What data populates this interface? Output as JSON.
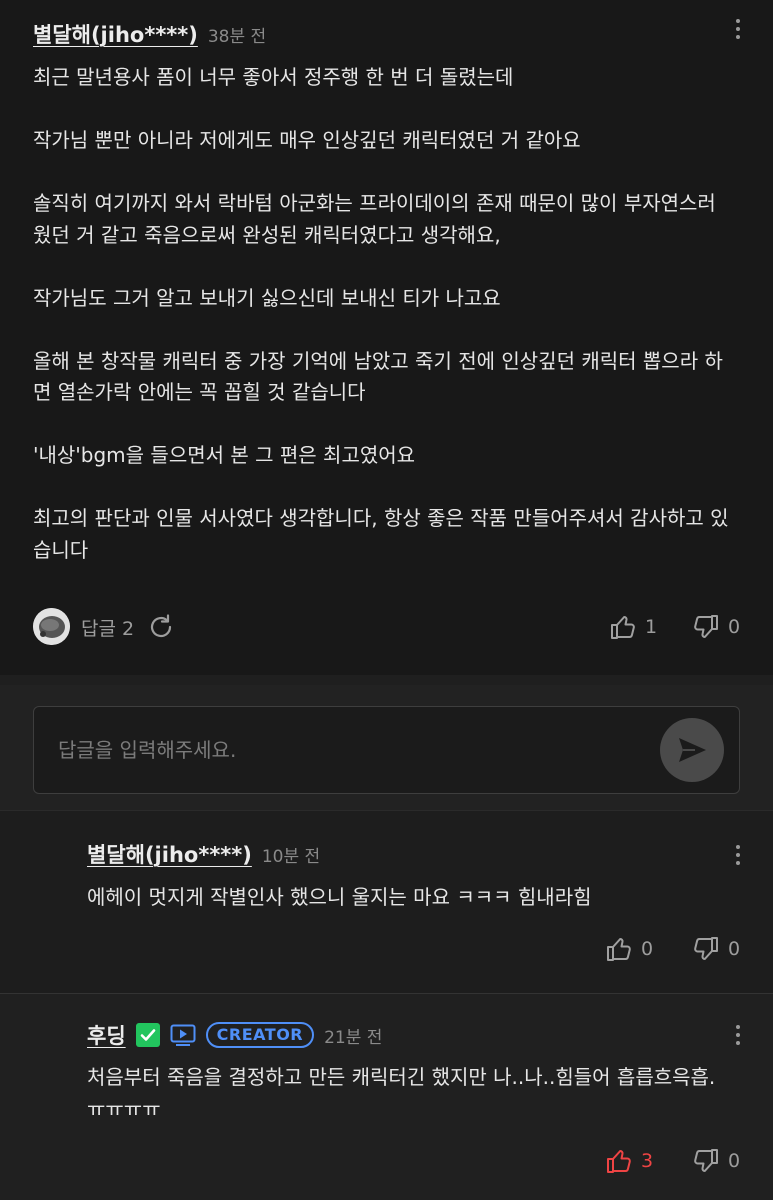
{
  "comment": {
    "author": "별달해(jiho****)",
    "time": "38분 전",
    "paragraphs": [
      "최근 말년용사 폼이 너무 좋아서 정주행 한 번 더 돌렸는데",
      "작가님 뿐만 아니라 저에게도 매우 인상깊던 캐릭터였던 거 같아요",
      "솔직히 여기까지 와서 락바텀 아군화는 프라이데이의 존재 때문이 많이 부자연스러웠던 거 같고 죽음으로써 완성된 캐릭터였다고 생각해요,",
      "작가님도 그거 알고 보내기 싫으신데 보내신 티가 나고요",
      "올해 본 창작물 캐릭터 중 가장 기억에 남았고 죽기 전에 인상깊던 캐릭터 뽑으라 하면 열손가락 안에는 꼭 꼽힐 것 같습니다",
      "'내상'bgm을 들으면서 본 그 편은 최고였어요",
      "최고의 판단과 인물 서사였다 생각합니다, 항상 좋은 작품 만들어주셔서 감사하고 있습니다"
    ],
    "replies_label": "답글 2",
    "likes": "1",
    "dislikes": "0"
  },
  "reply_input": {
    "placeholder": "답글을 입력해주세요."
  },
  "replies": [
    {
      "author": "별달해(jiho****)",
      "time": "10분 전",
      "text": "에헤이 멋지게 작별인사 했으니 울지는 마요 ㅋㅋㅋ 힘내라힘",
      "likes": "0",
      "dislikes": "0"
    },
    {
      "author": "후딩",
      "badge": "CREATOR",
      "time": "21분 전",
      "text": "처음부터 죽음을 결정하고 만든 캐릭터긴 했지만 나..나..힘들어 흡릅흐윽흡.ㅠㅠㅠㅠ",
      "likes": "3",
      "dislikes": "0",
      "liked": true
    }
  ],
  "colors": {
    "background": "#181818",
    "verified_green": "#22c55e",
    "creator_blue": "#4f8ff7",
    "liked_red": "#ef4444"
  }
}
